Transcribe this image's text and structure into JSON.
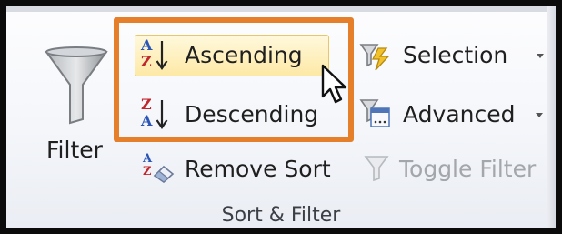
{
  "ribbon": {
    "group_name": "Sort & Filter",
    "filter_label": "Filter",
    "buttons": [
      {
        "label": "Ascending",
        "icon": "sort-a-to-z-icon",
        "state": "hovered"
      },
      {
        "label": "Descending",
        "icon": "sort-z-to-a-icon"
      },
      {
        "label": "Remove Sort",
        "icon": "remove-sort-icon"
      },
      {
        "label": "Selection",
        "icon": "sort-by-selection-icon",
        "has_dropdown": true
      },
      {
        "label": "Advanced",
        "icon": "advanced-filter-icon",
        "has_dropdown": true
      },
      {
        "label": "Toggle Filter",
        "icon": "toggle-filter-icon",
        "enabled": false
      }
    ]
  },
  "icon_glyphs": {
    "asc_top": "A",
    "asc_bottom": "Z",
    "desc_top": "Z",
    "desc_bottom": "A"
  },
  "colors": {
    "highlight": "#e57f2a",
    "hover_fill": "#fde9a6",
    "letter_a": "#2b56b5",
    "letter_z": "#c0282e",
    "arrow": "#222222",
    "disabled_text": "#a3a6ab"
  }
}
